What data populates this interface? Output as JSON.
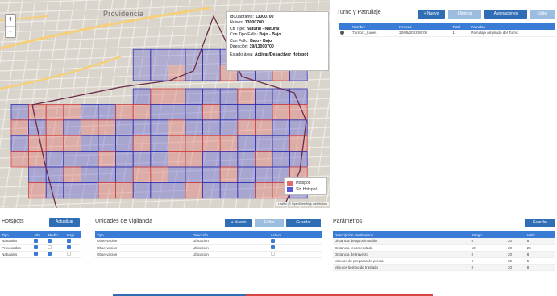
{
  "map": {
    "place_label": "Providencia",
    "zoom_in": "+",
    "zoom_out": "−",
    "popup": {
      "lines": [
        {
          "k": "IdCuadrante: ",
          "v": "13000700"
        },
        {
          "k": "Huisos: ",
          "v": "13000700"
        },
        {
          "k": "Ctr Tipo: ",
          "v": "Natural - Natural"
        },
        {
          "k": "Con Tipo Fallo: ",
          "v": "Bajo - Bajo"
        },
        {
          "k": "Con Fallo: ",
          "v": "Bajo - Bajo"
        },
        {
          "k": "Dirección: ",
          "v": "19/13000700"
        }
      ],
      "footer_k": "Estado área: ",
      "footer_v": "Activar/Desactivar Hotspot"
    },
    "legend": [
      {
        "label": "Hotspot",
        "color": "#e26a6a"
      },
      {
        "label": "Sin Hotspot",
        "color": "#5a5ad6"
      }
    ],
    "attribution": "Leaflet | © OpenStreetMap contributors"
  },
  "turnos": {
    "title": "Turno y Patrullaje",
    "buttons": [
      "+ Nuevo",
      "Eliminar",
      "Asignaciones",
      "Editar"
    ],
    "columns": [
      "",
      "Nombre",
      "Periodo",
      "Total",
      "Patrullas"
    ],
    "rows": [
      [
        "",
        "Turno/1_Lunes",
        "22/05/2023 06:00",
        "1",
        "Patrullaje ampliado del Turno"
      ]
    ]
  },
  "hotspots": {
    "title": "Hotspots",
    "button": "Actualizar",
    "columns": [
      "Tipo",
      "Alto",
      "Medio",
      "Bajo"
    ],
    "rows": [
      {
        "label": "Naturales",
        "checks": [
          true,
          true,
          true
        ]
      },
      {
        "label": "Provocados",
        "checks": [
          true,
          false,
          true
        ]
      },
      {
        "label": "Naturales",
        "checks": [
          true,
          true,
          false
        ]
      }
    ]
  },
  "unidades": {
    "title": "Unidades de Vigilancia",
    "buttons": [
      "+ Nuevo",
      "Editar",
      "Guardar"
    ],
    "columns": [
      "Tipo",
      "Dirección",
      "Activo"
    ],
    "rows": [
      {
        "tipo": "Observación",
        "dir": "Ubicación",
        "on": true
      },
      {
        "tipo": "Observación",
        "dir": "Ubicación",
        "on": true
      },
      {
        "tipo": "Observación",
        "dir": "Ubicación",
        "on": false
      }
    ]
  },
  "parametros": {
    "title": "Parámetros",
    "button": "Guardar",
    "columns": [
      "Descripción Parámetros",
      "Rango",
      "",
      "Valor"
    ],
    "rows": [
      [
        "Distancia de aproximación",
        "0",
        "20",
        "8"
      ],
      [
        "Distancia recomendada",
        "10",
        "30",
        "20"
      ],
      [
        "Distancia de trayecto",
        "0",
        "20",
        "8"
      ],
      [
        "Minutos de preparación previa",
        "0",
        "20",
        "5"
      ],
      [
        "Minutos tiempo de traslado",
        "0",
        "20",
        "8"
      ]
    ]
  },
  "colors": {
    "accent": "#2f6db5",
    "hotspot": "#e26a6a",
    "nohotspot": "#5a5ad6"
  }
}
